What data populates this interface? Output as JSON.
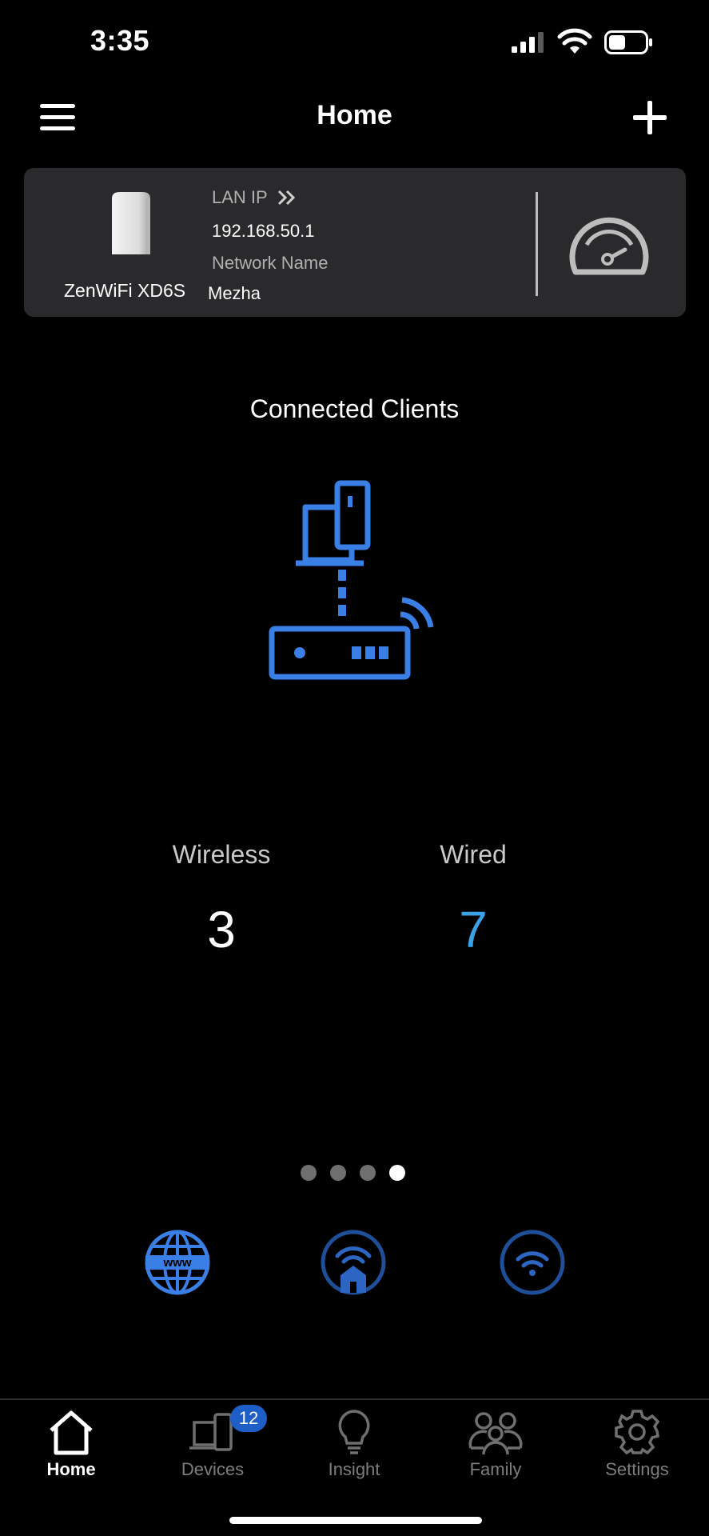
{
  "status_bar": {
    "time": "3:35",
    "signal_icon": "cellular-signal-icon",
    "wifi_icon": "wifi-status-icon",
    "battery_icon": "battery-icon"
  },
  "nav": {
    "title": "Home",
    "menu_icon": "hamburger-menu-icon",
    "add_icon": "plus-icon"
  },
  "router_card": {
    "device_name": "ZenWiFi XD6S",
    "lan_ip_label": "LAN IP",
    "lan_ip_value": "192.168.50.1",
    "network_name_label": "Network Name",
    "network_name_value": "Mezha",
    "speed_icon": "speedometer-icon"
  },
  "clients": {
    "title": "Connected Clients",
    "wireless_label": "Wireless",
    "wireless_count": "3",
    "wired_label": "Wired",
    "wired_count": "7"
  },
  "pager": {
    "count": 4,
    "active_index": 3
  },
  "quick_icons": [
    "internet-globe-icon",
    "home-network-icon",
    "wifi-icon"
  ],
  "tabs": [
    {
      "label": "Home",
      "icon": "home-icon",
      "active": true
    },
    {
      "label": "Devices",
      "icon": "devices-icon",
      "badge": "12"
    },
    {
      "label": "Insight",
      "icon": "lightbulb-icon"
    },
    {
      "label": "Family",
      "icon": "family-icon"
    },
    {
      "label": "Settings",
      "icon": "gear-icon"
    }
  ],
  "colors": {
    "accent": "#3a7fe6",
    "wired_value": "#3aa3e8",
    "card_bg": "#2a2a2c",
    "badge": "#1d5fc7"
  }
}
